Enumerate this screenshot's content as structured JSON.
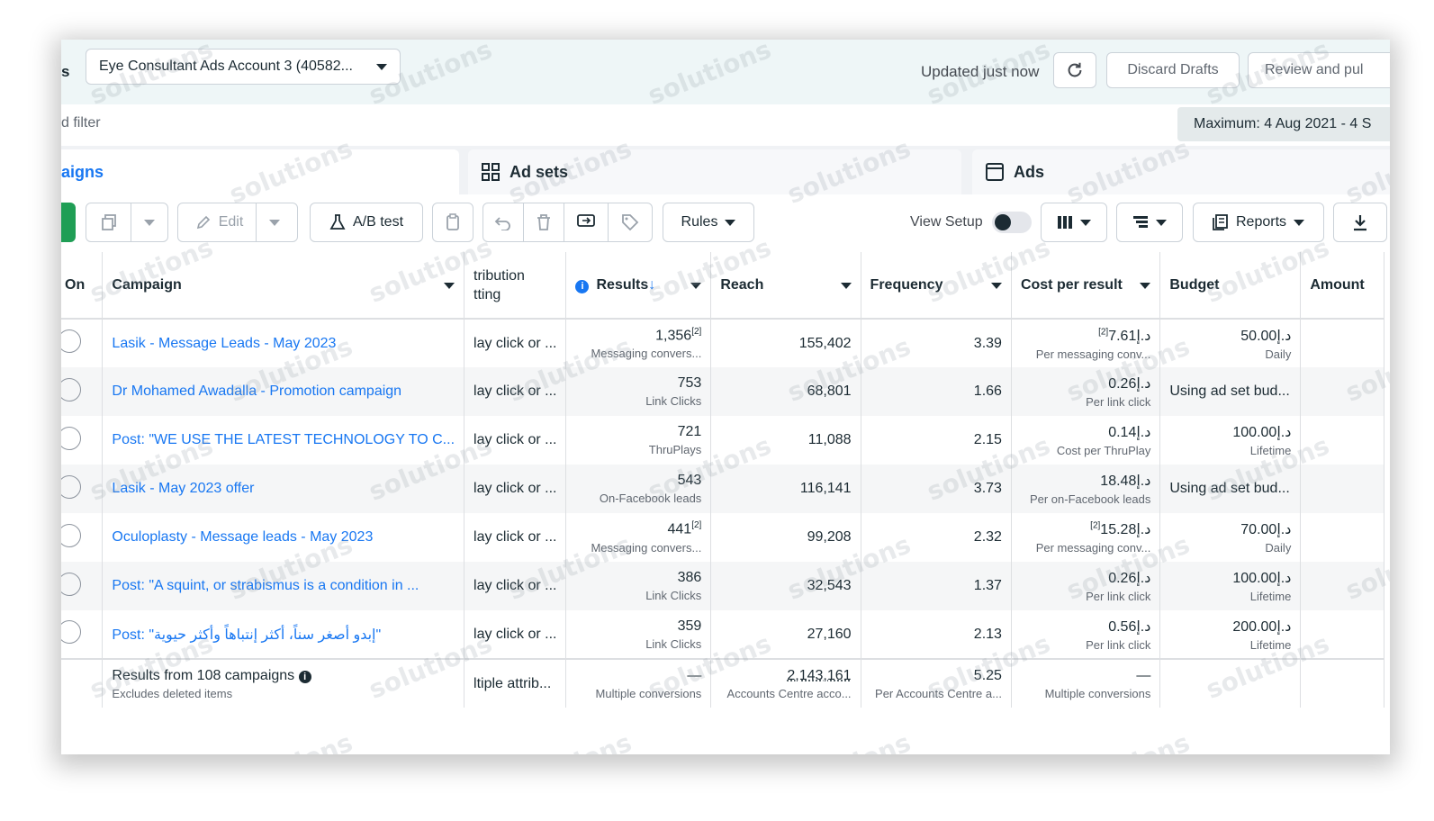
{
  "header": {
    "left_fragment": "s",
    "account_dropdown": "Eye Consultant Ads Account 3 (40582...",
    "updated_status": "Updated just now",
    "discard_drafts": "Discard Drafts",
    "review_publish": "Review and pul"
  },
  "filter": {
    "placeholder_fragment": "d filter",
    "date_range": "Maximum: 4 Aug 2021 - 4 S"
  },
  "tabs": {
    "campaigns": "aigns",
    "ad_sets": "Ad sets",
    "ads": "Ads"
  },
  "toolbar": {
    "edit": "Edit",
    "ab_test": "A/B test",
    "rules": "Rules",
    "view_setup": "View Setup",
    "reports": "Reports"
  },
  "table": {
    "columns": {
      "on": "On",
      "campaign": "Campaign",
      "attribution_line1": "tribution",
      "attribution_line2": "tting",
      "results": "Results",
      "reach": "Reach",
      "frequency": "Frequency",
      "cost_per_result": "Cost per result",
      "budget": "Budget",
      "amount": "Amount"
    },
    "rows": [
      {
        "campaign": "Lasik - Message Leads - May 2023",
        "attribution": "lay click or ...",
        "results": "1,356",
        "results_note": "[2]",
        "results_sub": "Messaging convers...",
        "reach": "155,402",
        "frequency": "3.39",
        "cost": "د.إ7.61",
        "cost_note": "[2]",
        "cost_sub": "Per messaging conv...",
        "budget": "د.إ50.00",
        "budget_sub": "Daily"
      },
      {
        "campaign": "Dr Mohamed Awadalla - Promotion campaign",
        "attribution": "lay click or ...",
        "results": "753",
        "results_note": "",
        "results_sub": "Link Clicks",
        "reach": "68,801",
        "frequency": "1.66",
        "cost": "د.إ0.26",
        "cost_note": "",
        "cost_sub": "Per link click",
        "budget": "Using ad set bud...",
        "budget_sub": ""
      },
      {
        "campaign": "Post: \"WE USE THE LATEST TECHNOLOGY TO C...",
        "attribution": "lay click or ...",
        "results": "721",
        "results_note": "",
        "results_sub": "ThruPlays",
        "reach": "11,088",
        "frequency": "2.15",
        "cost": "د.إ0.14",
        "cost_note": "",
        "cost_sub": "Cost per ThruPlay",
        "budget": "د.إ100.00",
        "budget_sub": "Lifetime"
      },
      {
        "campaign": "Lasik - May 2023 offer",
        "attribution": "lay click or ...",
        "results": "543",
        "results_note": "",
        "results_sub": "On-Facebook leads",
        "reach": "116,141",
        "frequency": "3.73",
        "cost": "د.إ18.48",
        "cost_note": "",
        "cost_sub": "Per on-Facebook leads",
        "budget": "Using ad set bud...",
        "budget_sub": ""
      },
      {
        "campaign": "Oculoplasty - Message leads - May 2023",
        "attribution": "lay click or ...",
        "results": "441",
        "results_note": "[2]",
        "results_sub": "Messaging convers...",
        "reach": "99,208",
        "frequency": "2.32",
        "cost": "د.إ15.28",
        "cost_note": "[2]",
        "cost_sub": "Per messaging conv...",
        "budget": "د.إ70.00",
        "budget_sub": "Daily"
      },
      {
        "campaign": "Post: \"A squint, or strabismus is a condition in ...",
        "attribution": "lay click or ...",
        "results": "386",
        "results_note": "",
        "results_sub": "Link Clicks",
        "reach": "32,543",
        "frequency": "1.37",
        "cost": "د.إ0.26",
        "cost_note": "",
        "cost_sub": "Per link click",
        "budget": "د.إ100.00",
        "budget_sub": "Lifetime"
      },
      {
        "campaign": "Post: \"إبدو أصغر سناً، أكثر إنتباهاً وأكثر حيوية\"",
        "attribution": "lay click or ...",
        "results": "359",
        "results_note": "",
        "results_sub": "Link Clicks",
        "reach": "27,160",
        "frequency": "2.13",
        "cost": "د.إ0.56",
        "cost_note": "",
        "cost_sub": "Per link click",
        "budget": "د.إ200.00",
        "budget_sub": "Lifetime"
      }
    ],
    "footer": {
      "title": "Results from 108 campaigns",
      "subtitle": "Excludes deleted items",
      "attribution": "ltiple attrib...",
      "results": "—",
      "results_sub": "Multiple conversions",
      "reach": "2,143,161",
      "reach_sub": "Accounts Centre acco...",
      "frequency": "5.25",
      "frequency_sub": "Per Accounts Centre a...",
      "cost": "—",
      "cost_sub": "Multiple conversions"
    }
  },
  "watermark": "solutions",
  "colors": {
    "accent": "#1877f2",
    "green": "#1f9e55",
    "text": "#1c2b33"
  }
}
